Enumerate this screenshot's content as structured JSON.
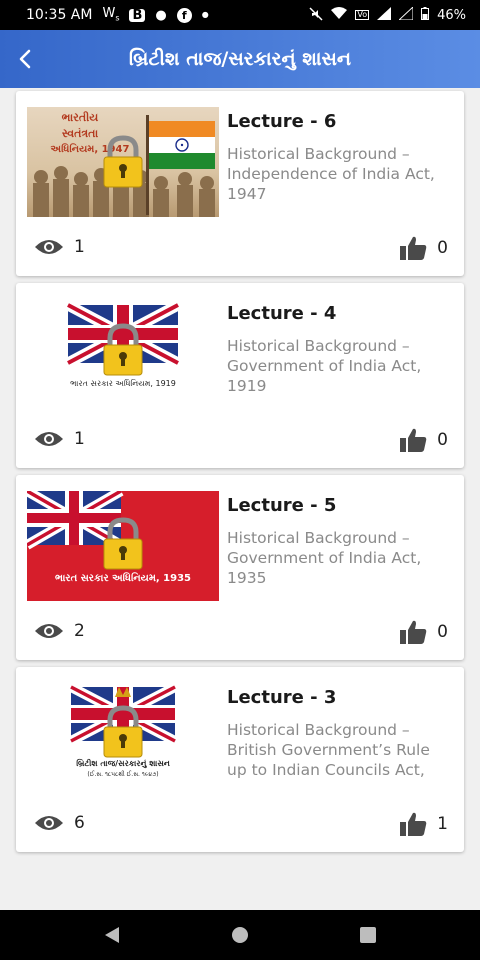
{
  "status_bar": {
    "time": "10:35 AM",
    "battery": "46%",
    "icons": [
      "whatsapp-icon",
      "app-b-icon",
      "circle-icon",
      "facebook-icon",
      "dot-icon",
      "mute-icon",
      "wifi-icon",
      "volte-icon",
      "signal-icon",
      "signal-empty-icon",
      "battery-icon"
    ]
  },
  "app_bar": {
    "title": "બ્રિટીશ તાજ/સરકારનું શાસન",
    "back_icon": "back-arrow-icon"
  },
  "colors": {
    "app_bar_start": "#3567c9",
    "app_bar_end": "#5b8de4",
    "icon_gray": "#4a4a4a"
  },
  "lectures": [
    {
      "title": "Lecture - 6",
      "description": "Historical Background – Independence of India Act, 1947",
      "views": "1",
      "likes": "0",
      "thumb_text": [
        "ભારતીય",
        "સ્વતંત્રતા",
        "અધિનિયમ, 1947"
      ]
    },
    {
      "title": "Lecture - 4",
      "description": "Historical Background – Government of India Act, 1919",
      "views": "1",
      "likes": "0",
      "thumb_text": [
        "ભારત સરકાર અધિનિયમ, 1919"
      ]
    },
    {
      "title": "Lecture - 5",
      "description": "Historical Background – Government of India Act, 1935",
      "views": "2",
      "likes": "0",
      "thumb_text": [
        "ભારત સરકાર અધિનિયમ, 1935"
      ]
    },
    {
      "title": "Lecture - 3",
      "description": "Historical Background – British Government’s Rule up to Indian Councils Act,",
      "views": "6",
      "likes": "1",
      "thumb_text": [
        "બ્રિટીશ તાજ/સરકારનું શાસન",
        "(ઈ.સ. ૧૮૫૮થી ઈ.સ. ૧૯૪૭)"
      ]
    }
  ]
}
